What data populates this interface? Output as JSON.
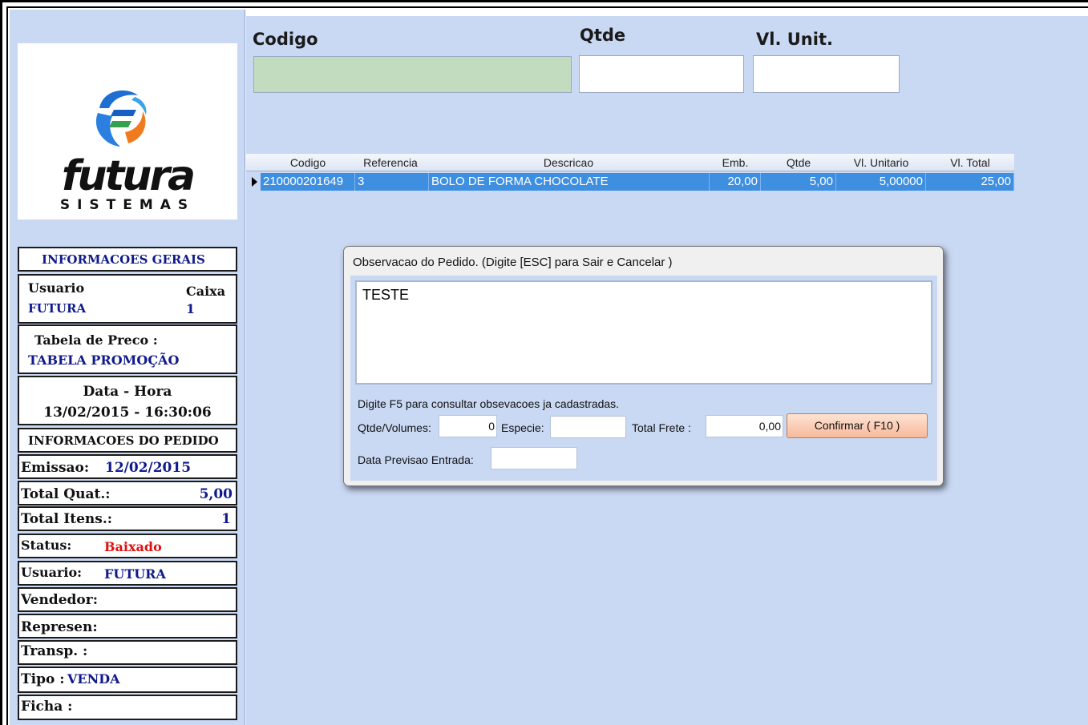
{
  "header": {
    "codigo_label": "Codigo",
    "qtde_label": "Qtde",
    "vl_unit_label": "Vl. Unit."
  },
  "logo": {
    "brand": "futura",
    "tagline": "SISTEMAS"
  },
  "sidebar": {
    "info_gerais": "INFORMACOES GERAIS",
    "usuario_label": "Usuario",
    "usuario_value": "FUTURA",
    "caixa_label": "Caixa",
    "caixa_value": "1",
    "tabela_label": "Tabela de Preco :",
    "tabela_value": "TABELA PROMOÇÃO",
    "datahora_label": "Data - Hora",
    "datahora_value": "13/02/2015 - 16:30:06",
    "info_pedido": "INFORMACOES DO PEDIDO",
    "emissao_label": "Emissao:",
    "emissao_value": "12/02/2015",
    "total_quat_label": "Total Quat.:",
    "total_quat_value": "5,00",
    "total_itens_label": "Total Itens.:",
    "total_itens_value": "1",
    "status_label": "Status:",
    "status_value": "Baixado",
    "usuario2_label": "Usuario:",
    "usuario2_value": "FUTURA",
    "vendedor_label": "Vendedor:",
    "represen_label": "Represen:",
    "transp_label": "Transp. :",
    "tipo_label": "Tipo :",
    "tipo_value": "VENDA",
    "ficha_label": "Ficha :"
  },
  "grid": {
    "columns": [
      "Codigo",
      "Referencia",
      "Descricao",
      "Emb.",
      "Qtde",
      "Vl. Unitario",
      "Vl. Total"
    ],
    "row": {
      "codigo": "210000201649",
      "referencia": "3",
      "descricao": "BOLO DE FORMA CHOCOLATE",
      "emb": "20,00",
      "qtde": "5,00",
      "vl_unitario": "5,00000",
      "vl_total": "25,00"
    }
  },
  "dialog": {
    "title": "Observacao do Pedido. (Digite [ESC] para Sair e Cancelar )",
    "text": "TESTE",
    "hint": "Digite F5 para consultar obsevacoes ja cadastradas.",
    "qtde_volumes_label": "Qtde/Volumes:",
    "qtde_volumes_value": "0",
    "especie_label": "Especie:",
    "especie_value": "",
    "total_frete_label": "Total Frete :",
    "total_frete_value": "0,00",
    "confirm_label": "Confirmar ( F10 )",
    "data_previsao_label": "Data Previsao Entrada:",
    "data_previsao_value": ""
  },
  "colors": {
    "panel": "#c9d8f3",
    "selection": "#3e8fe0",
    "codigo_field": "#c2dcc0",
    "status_red": "#e01010",
    "value_blue": "#101a8c"
  }
}
